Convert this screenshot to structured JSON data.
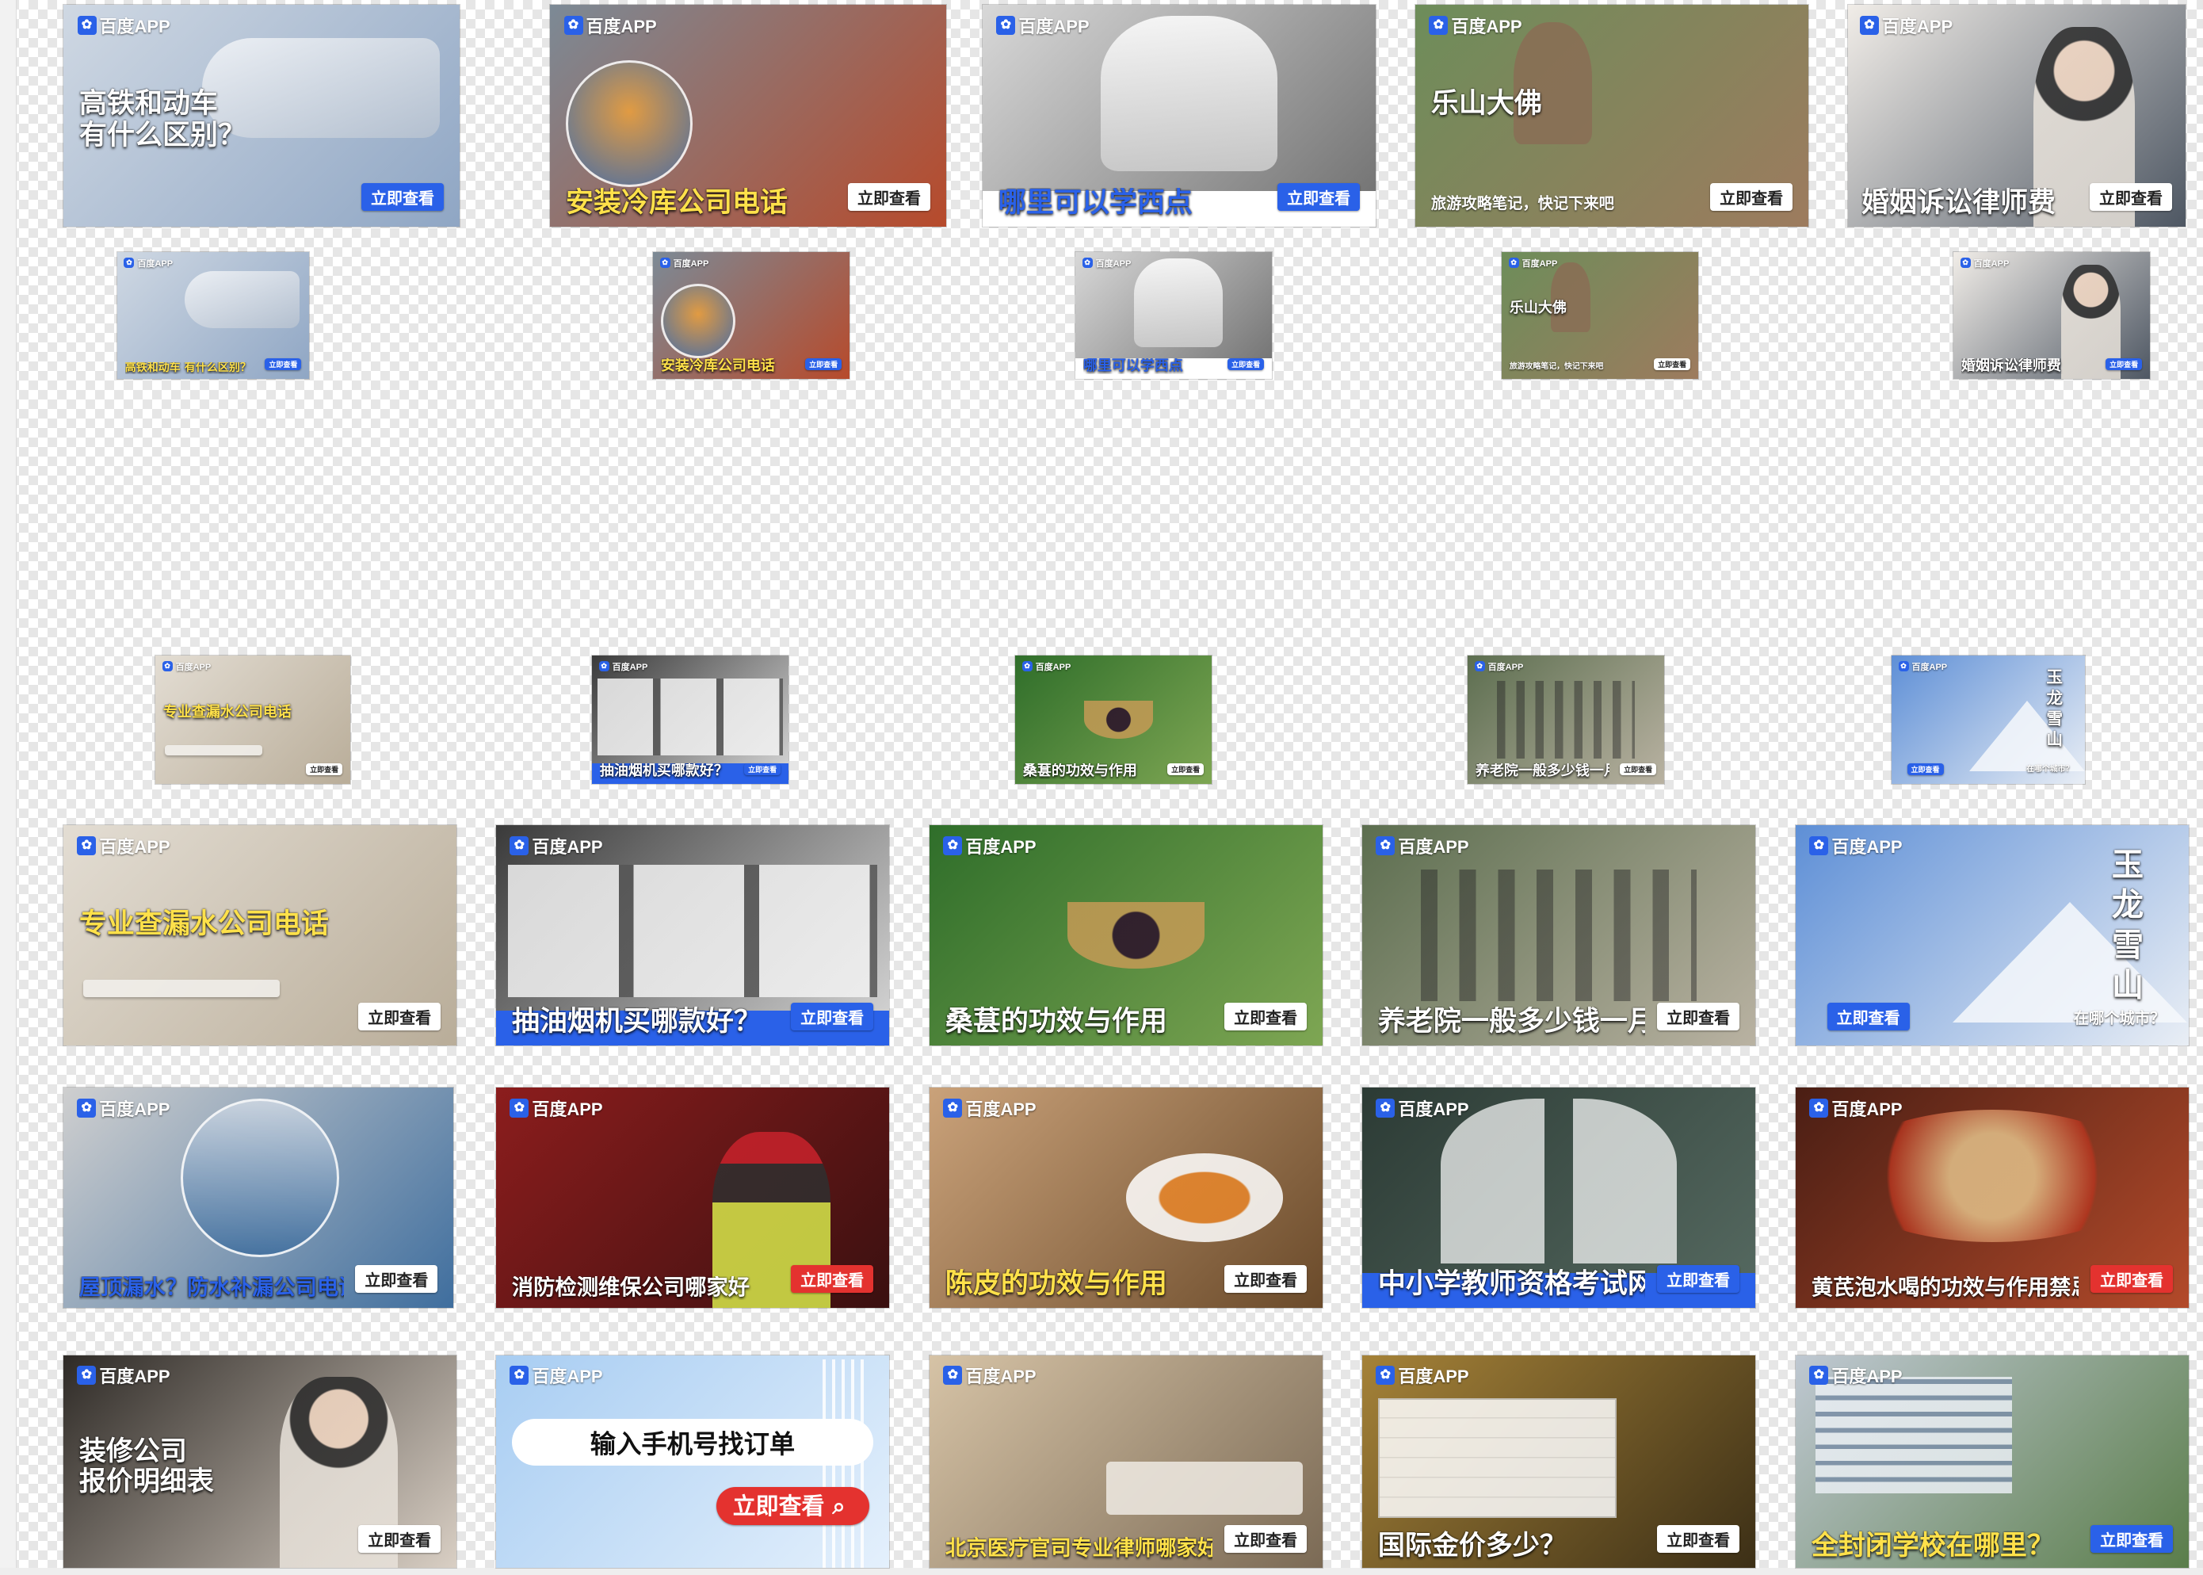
{
  "brand": {
    "paw_glyph": "✿",
    "name": "百度APP"
  },
  "rows": [
    {
      "size": "large",
      "cards": [
        {
          "title": "高铁和动车\n有什么区别？",
          "cta": "立即查看",
          "bg": [
            "#cfd8e3",
            "#8fa6c4"
          ],
          "title_color": "#ffffff",
          "title_pos": "mid",
          "cta_style": "blue",
          "icon": "train-icon"
        },
        {
          "title": "安装冷库公司电话",
          "cta": "立即查看",
          "bg": [
            "#7c8a96",
            "#b74a2b"
          ],
          "title_color": "#ffe14a",
          "title_pos": "bottom",
          "cta_style": "white",
          "icon": "worker-icon"
        },
        {
          "title": "哪里可以学西点",
          "cta": "立即查看",
          "bg": [
            "#d8d8d8",
            "#6f6f6f"
          ],
          "title_color": "#2a61e8",
          "title_pos": "bottom",
          "cta_style": "blue",
          "band": "#ffffff",
          "icon": "chef-icon"
        },
        {
          "title": "乐山大佛",
          "subtitle": "旅游攻略笔记，快记下来吧",
          "cta": "立即查看",
          "bg": [
            "#6d8d5a",
            "#9d7b5e"
          ],
          "title_color": "#ffffff",
          "title_pos": "mid",
          "cta_style": "white",
          "icon": "buddha-icon"
        },
        {
          "title": "婚姻诉讼律师费",
          "cta": "立即查看",
          "bg": [
            "#f1ede8",
            "#4e5763"
          ],
          "title_color": "#ffffff",
          "title_pos": "bottom",
          "cta_style": "white",
          "icon": "person-icon"
        }
      ]
    },
    {
      "size": "small",
      "cards": [
        {
          "title": "高铁和动车\n有什么区别？",
          "cta": "立即查看",
          "bg": [
            "#cfd8e3",
            "#8fa6c4"
          ],
          "title_color": "#ffe14a",
          "title_pos": "bottom",
          "cta_style": "blue",
          "icon": "train-icon"
        },
        {
          "title": "安装冷库公司电话",
          "cta": "立即查看",
          "bg": [
            "#7c8a96",
            "#b74a2b"
          ],
          "title_color": "#ffe14a",
          "title_pos": "bottom",
          "cta_style": "blue",
          "icon": "worker-icon"
        },
        {
          "title": "哪里可以学西点",
          "cta": "立即查看",
          "bg": [
            "#d8d8d8",
            "#6f6f6f"
          ],
          "title_color": "#2a61e8",
          "title_pos": "bottom",
          "cta_style": "blue",
          "band": "#ffffff",
          "icon": "chef-icon"
        },
        {
          "title": "乐山大佛",
          "subtitle": "旅游攻略笔记，快记下来吧",
          "cta": "立即查看",
          "bg": [
            "#6d8d5a",
            "#9d7b5e"
          ],
          "title_color": "#ffffff",
          "title_pos": "mid",
          "cta_style": "white",
          "icon": "buddha-icon"
        },
        {
          "title": "婚姻诉讼律师费",
          "cta": "立即查看",
          "bg": [
            "#f1ede8",
            "#4e5763"
          ],
          "title_color": "#ffffff",
          "title_pos": "bottom",
          "cta_style": "blue",
          "icon": "person-icon"
        }
      ]
    },
    {
      "size": "small",
      "cards": [
        {
          "title": "专业查漏水公司电话",
          "cta": "立即查看",
          "bg": [
            "#e3ddd3",
            "#b9ad99"
          ],
          "title_color": "#ffe14a",
          "title_pos": "mid",
          "cta_style": "white",
          "icon": "pipe-icon"
        },
        {
          "title": "抽油烟机买哪款好？",
          "cta": "立即查看",
          "bg": [
            "#3a3a3a",
            "#d9d9d9"
          ],
          "title_color": "#ffffff",
          "title_pos": "bottom",
          "cta_style": "blue",
          "band": "#2a61e8",
          "icon": "hood-icon"
        },
        {
          "title": "桑葚的功效与作用",
          "cta": "立即查看",
          "bg": [
            "#2f6e2a",
            "#7ea653"
          ],
          "title_color": "#ffffff",
          "title_pos": "bottom",
          "cta_style": "white",
          "icon": "berry-icon"
        },
        {
          "title": "养老院一般多少钱一月",
          "cta": "立即查看",
          "bg": [
            "#5c6e4f",
            "#b9b2a2"
          ],
          "title_color": "#ffffff",
          "title_pos": "bottom",
          "cta_style": "white",
          "icon": "elder-icon"
        },
        {
          "title": "玉龙雪山",
          "subtitle": "在哪个城市？",
          "cta": "立即查看",
          "bg": [
            "#5e8fd6",
            "#e9eef5"
          ],
          "title_color": "#ffffff",
          "title_pos": "right",
          "cta_style": "blue",
          "icon": "mountain-icon"
        }
      ]
    },
    {
      "size": "large",
      "cards": [
        {
          "title": "专业查漏水公司电话",
          "cta": "立即查看",
          "bg": [
            "#e3ddd3",
            "#b9ad99"
          ],
          "title_color": "#ffe14a",
          "title_pos": "mid",
          "cta_style": "white",
          "icon": "pipe-icon"
        },
        {
          "title": "抽油烟机买哪款好？",
          "cta": "立即查看",
          "bg": [
            "#3a3a3a",
            "#d9d9d9"
          ],
          "title_color": "#ffffff",
          "title_pos": "bottom",
          "cta_style": "blue",
          "band": "#2a61e8",
          "icon": "hood-icon"
        },
        {
          "title": "桑葚的功效与作用",
          "cta": "立即查看",
          "bg": [
            "#2f6e2a",
            "#7ea653"
          ],
          "title_color": "#ffffff",
          "title_pos": "bottom",
          "cta_style": "white",
          "icon": "berry-icon"
        },
        {
          "title": "养老院一般多少钱一月",
          "cta": "立即查看",
          "bg": [
            "#5c6e4f",
            "#b9b2a2"
          ],
          "title_color": "#ffffff",
          "title_pos": "bottom",
          "cta_style": "white",
          "icon": "elder-icon"
        },
        {
          "title": "玉龙雪山",
          "subtitle": "在哪个城市？",
          "cta": "立即查看",
          "bg": [
            "#5e8fd6",
            "#e9eef5"
          ],
          "title_color": "#ffffff",
          "title_pos": "right",
          "cta_style": "blue",
          "icon": "mountain-icon"
        }
      ]
    },
    {
      "size": "large",
      "cards": [
        {
          "title": "屋顶漏水？防水补漏公司电话",
          "cta": "立即查看",
          "bg": [
            "#cfcfcf",
            "#3f6e9e"
          ],
          "title_color": "#2a61e8",
          "title_pos": "bottom",
          "cta_style": "white",
          "icon": "roof-icon"
        },
        {
          "title": "消防检测维保公司哪家好",
          "cta": "立即查看",
          "bg": [
            "#8c1d1d",
            "#3a1010"
          ],
          "title_color": "#ffffff",
          "title_pos": "bottom",
          "cta_style": "red",
          "icon": "fire-icon"
        },
        {
          "title": "陈皮的功效与作用",
          "cta": "立即查看",
          "bg": [
            "#caa27a",
            "#6a4a2a"
          ],
          "title_color": "#ffe14a",
          "title_pos": "bottom",
          "cta_style": "white",
          "icon": "peel-icon"
        },
        {
          "title": "中小学教师资格考试网",
          "cta": "立即查看",
          "bg": [
            "#2c3b35",
            "#566a61"
          ],
          "title_color": "#ffffff",
          "title_pos": "bottom",
          "cta_style": "blue",
          "band": "#2a61e8",
          "icon": "teacher-icon"
        },
        {
          "title": "黄芪泡水喝的功效与作用禁忌！",
          "cta": "立即查看",
          "bg": [
            "#4a1e14",
            "#b34a2a"
          ],
          "title_color": "#ffffff",
          "title_pos": "bottom",
          "cta_style": "red",
          "icon": "herb-icon"
        }
      ]
    },
    {
      "size": "large",
      "cards": [
        {
          "title": "装修公司\n报价明细表",
          "cta": "立即查看",
          "bg": [
            "#2e2a26",
            "#d9cfc4"
          ],
          "title_color": "#ffffff",
          "title_pos": "mid",
          "cta_style": "white",
          "icon": "person-icon"
        },
        {
          "title": "输入手机号找订单",
          "cta": "立即查看",
          "bg": [
            "#a8cdf2",
            "#e4f0fc"
          ],
          "title_color": "#111111",
          "title_pos": "pill",
          "cta_style": "red",
          "icon": "search-icon"
        },
        {
          "title": "北京医疗官司专业律师哪家好？在线咨询",
          "cta": "立即查看",
          "bg": [
            "#d6c3a6",
            "#7b6a55"
          ],
          "title_color": "#ffe14a",
          "title_pos": "bottom",
          "cta_style": "white",
          "icon": "bed-icon"
        },
        {
          "title": "国际金价多少？",
          "cta": "立即查看",
          "bg": [
            "#a58238",
            "#3c2f16"
          ],
          "title_color": "#ffffff",
          "title_pos": "bottom",
          "cta_style": "white",
          "icon": "gold-icon"
        },
        {
          "title": "全封闭学校在哪里？",
          "cta": "立即查看",
          "bg": [
            "#bfc8d2",
            "#5a7d4a"
          ],
          "title_color": "#ffe14a",
          "title_pos": "bottom",
          "cta_style": "blue",
          "icon": "school-icon"
        }
      ]
    }
  ]
}
